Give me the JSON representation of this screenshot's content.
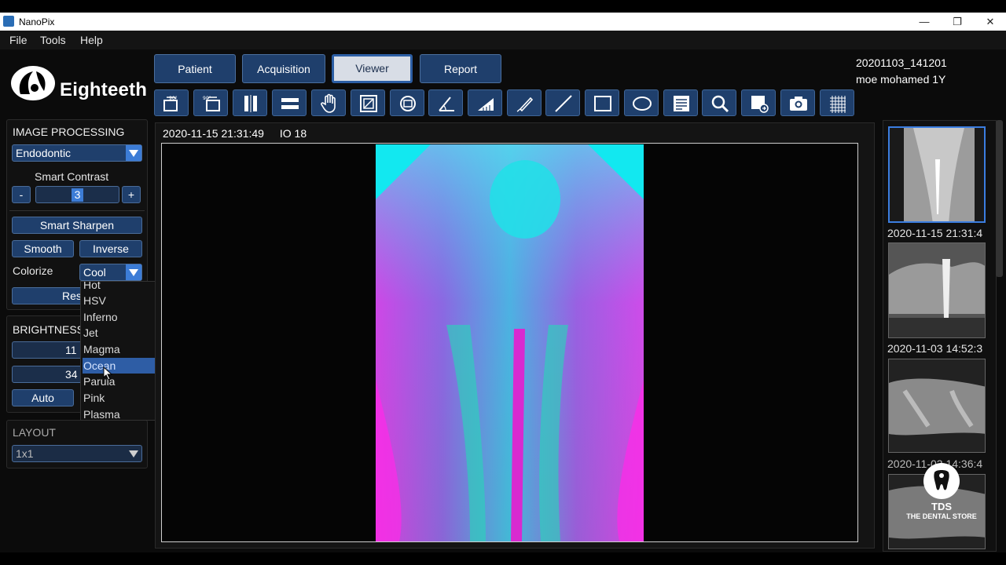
{
  "window": {
    "title": "NanoPix",
    "minimize": "—",
    "restore": "❐",
    "close": "✕"
  },
  "menu": [
    "File",
    "Tools",
    "Help"
  ],
  "logo": {
    "text": "Eighteeth"
  },
  "tabs": [
    {
      "label": "Patient",
      "active": false
    },
    {
      "label": "Acquisition",
      "active": false
    },
    {
      "label": "Viewer",
      "active": true
    },
    {
      "label": "Report",
      "active": false
    }
  ],
  "patient": {
    "id": "20201103_141201",
    "name": "moe mohamed 1Y"
  },
  "toolbar": [
    "rotate-left-icon",
    "rotate-right-icon",
    "flip-vertical-icon",
    "flip-horizontal-icon",
    "pan-hand-icon",
    "fit-image-icon",
    "reset-view-icon",
    "angle-measure-icon",
    "calibrate-icon",
    "draw-pen-icon",
    "line-icon",
    "rectangle-icon",
    "ellipse-icon",
    "text-note-icon",
    "magnifier-icon",
    "export-icon",
    "camera-icon",
    "grid-icon"
  ],
  "image_processing": {
    "title": "IMAGE PROCESSING",
    "mode": "Endodontic",
    "smart_contrast_label": "Smart Contrast",
    "minus": "-",
    "plus": "+",
    "contrast_value": "3",
    "smart_sharpen": "Smart Sharpen",
    "smooth": "Smooth",
    "inverse": "Inverse",
    "colorize_label": "Colorize",
    "colorize_value": "Cool",
    "reset_visible": "Res"
  },
  "colorize_options": [
    "Hot",
    "HSV",
    "Inferno",
    "Jet",
    "Magma",
    "Ocean",
    "Parula",
    "Pink",
    "Plasma"
  ],
  "colorize_highlighted": "Ocean",
  "brightness": {
    "title": "BRIGHTNESS",
    "value1": "11",
    "value2": "34",
    "auto": "Auto"
  },
  "layout": {
    "title": "LAYOUT",
    "value": "1x1"
  },
  "viewer": {
    "datetime": "2020-11-15 21:31:49",
    "tooth": "IO 18"
  },
  "thumbnails": [
    {
      "label": "2020-11-15 21:31:4",
      "active": true
    },
    {
      "label": "",
      "active": false
    },
    {
      "label": "2020-11-03 14:52:3",
      "active": false
    },
    {
      "label": "2020-11-03 14:36:4",
      "active": false
    }
  ],
  "watermark": {
    "brand": "TDS",
    "tagline": "THE DENTAL STORE"
  },
  "colors": {
    "accent": "#1f3f6c",
    "highlight": "#3c7cd6",
    "selection": "#2e5da5"
  }
}
